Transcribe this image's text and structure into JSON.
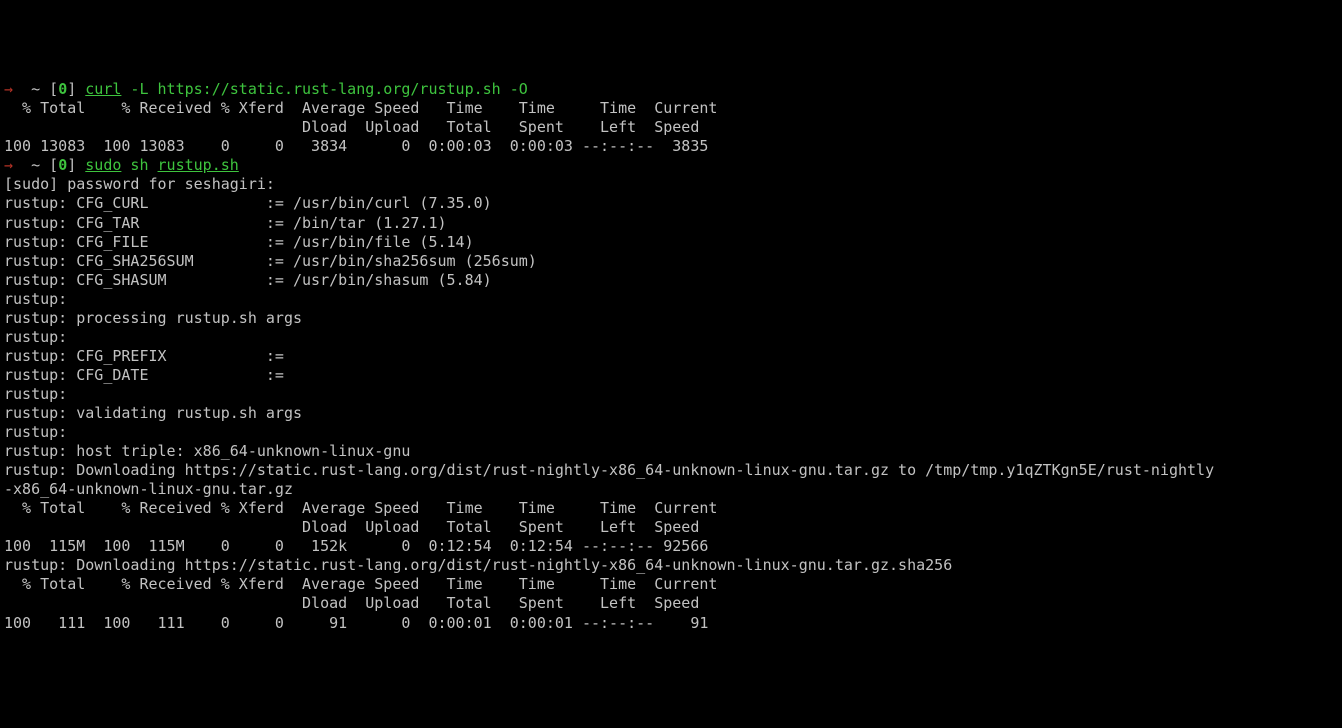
{
  "prompt1": {
    "arrow": "→",
    "tilde": "~",
    "lbracket": "[",
    "zero": "0",
    "rbracket": "]",
    "cmd": "curl",
    "args": " -L https://static.rust-lang.org/rustup.sh -O"
  },
  "curl_hdr1": "  % Total    % Received % Xferd  Average Speed   Time    Time     Time  Current",
  "curl_hdr2": "                                 Dload  Upload   Total   Spent    Left  Speed",
  "curl_row1": "100 13083  100 13083    0     0   3834      0  0:00:03  0:00:03 --:--:--  3835",
  "prompt2": {
    "arrow": "→",
    "tilde": "~",
    "lbracket": "[",
    "zero": "0",
    "rbracket": "]",
    "sudo": "sudo",
    "sh": " sh ",
    "file": "rustup.sh"
  },
  "sudo_line": "[sudo] password for seshagiri:",
  "r1": "rustup: CFG_CURL             := /usr/bin/curl (7.35.0)",
  "r2": "rustup: CFG_TAR              := /bin/tar (1.27.1)",
  "r3": "rustup: CFG_FILE             := /usr/bin/file (5.14)",
  "r4": "rustup: CFG_SHA256SUM        := /usr/bin/sha256sum (256sum)",
  "r5": "rustup: CFG_SHASUM           := /usr/bin/shasum (5.84)",
  "r6": "rustup:",
  "r7": "rustup: processing rustup.sh args",
  "r8": "rustup:",
  "r9": "rustup: CFG_PREFIX           :=",
  "r10": "rustup: CFG_DATE             :=",
  "r11": "rustup:",
  "r12": "rustup: validating rustup.sh args",
  "r13": "rustup:",
  "r14": "rustup: host triple: x86_64-unknown-linux-gnu",
  "r15": "rustup: Downloading https://static.rust-lang.org/dist/rust-nightly-x86_64-unknown-linux-gnu.tar.gz to /tmp/tmp.y1qZTKgn5E/rust-nightly",
  "r15b": "-x86_64-unknown-linux-gnu.tar.gz",
  "curl2_hdr1": "  % Total    % Received % Xferd  Average Speed   Time    Time     Time  Current",
  "curl2_hdr2": "                                 Dload  Upload   Total   Spent    Left  Speed",
  "curl2_row": "100  115M  100  115M    0     0   152k      0  0:12:54  0:12:54 --:--:-- 92566",
  "r16": "rustup: Downloading https://static.rust-lang.org/dist/rust-nightly-x86_64-unknown-linux-gnu.tar.gz.sha256",
  "curl3_hdr1": "  % Total    % Received % Xferd  Average Speed   Time    Time     Time  Current",
  "curl3_hdr2": "                                 Dload  Upload   Total   Spent    Left  Speed",
  "curl3_row": "100   111  100   111    0     0     91      0  0:00:01  0:00:01 --:--:--    91"
}
